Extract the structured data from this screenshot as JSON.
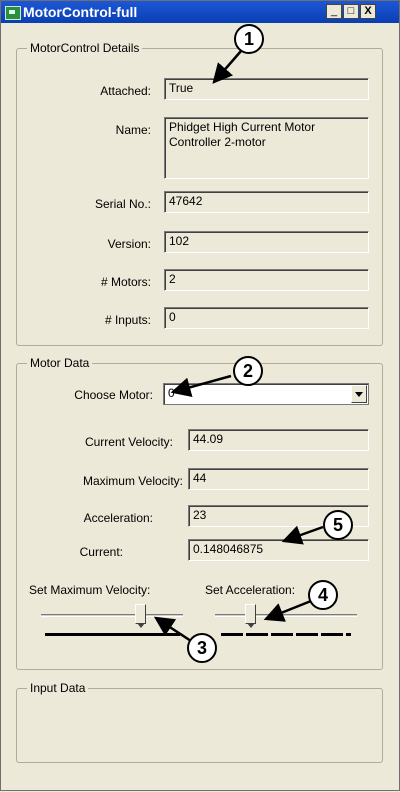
{
  "window": {
    "title": "MotorControl-full",
    "minimize": "_",
    "maximize": "□",
    "close": "X"
  },
  "details": {
    "title": "MotorControl Details",
    "attached_label": "Attached:",
    "attached_value": "True",
    "name_label": "Name:",
    "name_value": "Phidget High Current Motor\nController 2-motor",
    "serial_label": "Serial No.:",
    "serial_value": "47642",
    "version_label": "Version:",
    "version_value": "102",
    "motors_label": "# Motors:",
    "motors_value": "2",
    "inputs_label": "# Inputs:",
    "inputs_value": "0"
  },
  "motor_data": {
    "title": "Motor Data",
    "choose_label": "Choose Motor:",
    "choose_value": "0",
    "current_velocity_label": "Current Velocity:",
    "current_velocity_value": "44.09",
    "max_velocity_label": "Maximum Velocity:",
    "max_velocity_value": "44",
    "acceleration_label": "Acceleration:",
    "acceleration_value": "23",
    "current_label": "Current:",
    "current_value": "0.148046875",
    "set_max_velocity_label": "Set Maximum Velocity:",
    "set_acceleration_label": "Set Acceleration:",
    "max_velocity_slider_fraction": 0.72,
    "acceleration_slider_fraction": 0.23
  },
  "input_data": {
    "title": "Input Data"
  },
  "callouts": [
    "1",
    "2",
    "3",
    "4",
    "5"
  ]
}
